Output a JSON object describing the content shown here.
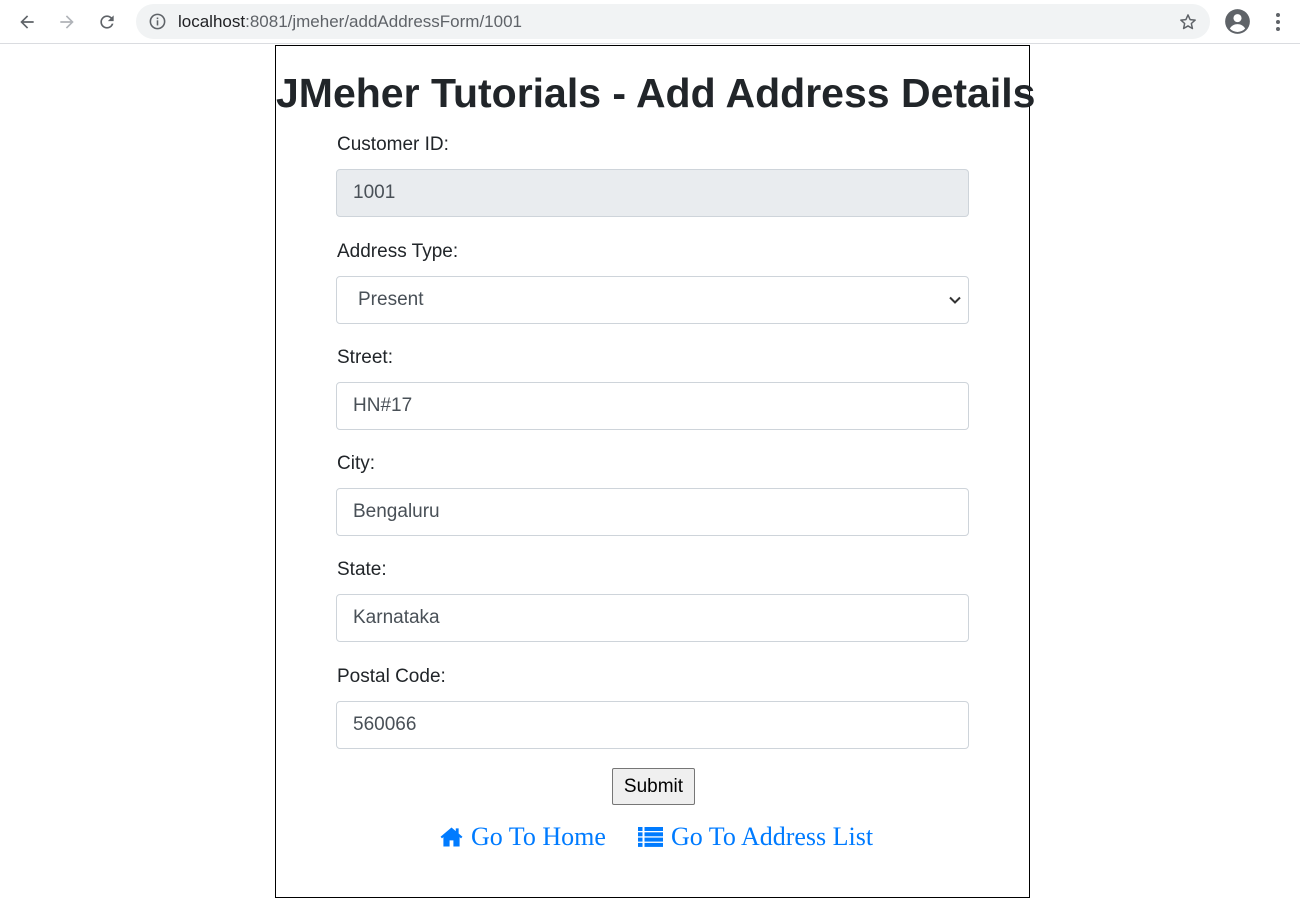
{
  "browser": {
    "url_host": "localhost",
    "url_rest": ":8081/jmeher/addAddressForm/1001",
    "icons": {
      "back": "arrow-left-icon",
      "forward": "arrow-right-icon",
      "reload": "reload-icon",
      "info": "info-icon",
      "bookmark": "star-icon",
      "account": "account-circle-icon",
      "menu": "more-vert-icon"
    }
  },
  "page": {
    "title": "JMeher Tutorials - Add Address Details"
  },
  "form": {
    "customer_id": {
      "label": "Customer ID:",
      "value": "1001"
    },
    "address_type": {
      "label": "Address Type:",
      "value": "Present"
    },
    "street": {
      "label": "Street:",
      "value": "HN#17"
    },
    "city": {
      "label": "City:",
      "value": "Bengaluru"
    },
    "state": {
      "label": "State:",
      "value": "Karnataka"
    },
    "postal_code": {
      "label": "Postal Code:",
      "value": "560066"
    },
    "submit_label": "Submit"
  },
  "links": {
    "home": {
      "label": "Go To Home",
      "icon": "home-icon"
    },
    "address_list": {
      "label": "Go To Address List",
      "icon": "list-icon"
    }
  },
  "colors": {
    "link": "#007bff",
    "readonly_bg": "#e9ecef",
    "input_border": "#ced4da",
    "text": "#212529"
  }
}
